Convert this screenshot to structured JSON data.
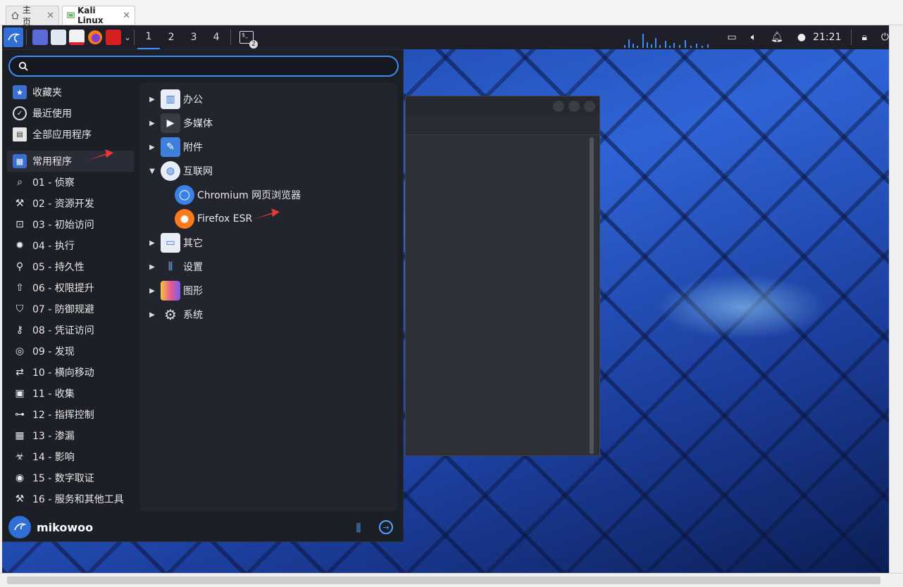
{
  "host": {
    "tabs": [
      {
        "label": "主页",
        "icon": "home-icon"
      },
      {
        "label": "Kali Linux",
        "icon": "vm-icon"
      }
    ]
  },
  "panel": {
    "workspaces": [
      "1",
      "2",
      "3",
      "4"
    ],
    "terminal_badge": "2",
    "clock": "21:21"
  },
  "menu": {
    "search": {
      "placeholder": "",
      "value": ""
    },
    "categories": [
      {
        "label": "收藏夹",
        "icon": "star-icon"
      },
      {
        "label": "最近使用",
        "icon": "recent-icon"
      },
      {
        "label": "全部应用程序",
        "icon": "all-apps-icon"
      },
      {
        "label": "常用程序",
        "icon": "grid-icon"
      },
      {
        "label": "01 - 侦察",
        "icon": "magnifier-icon"
      },
      {
        "label": "02 - 资源开发",
        "icon": "hammer-icon"
      },
      {
        "label": "03 - 初始访问",
        "icon": "lock-open-icon"
      },
      {
        "label": "04 - 执行",
        "icon": "explosion-icon"
      },
      {
        "label": "05 - 持久性",
        "icon": "persistence-icon"
      },
      {
        "label": "06 - 权限提升",
        "icon": "arrow-up-icon"
      },
      {
        "label": "07 - 防御规避",
        "icon": "shield-icon"
      },
      {
        "label": "08 - 凭证访问",
        "icon": "key-icon"
      },
      {
        "label": "09 - 发现",
        "icon": "radar-icon"
      },
      {
        "label": "10 - 横向移动",
        "icon": "arrows-lateral-icon"
      },
      {
        "label": "11 - 收集",
        "icon": "archive-icon"
      },
      {
        "label": "12 - 指挥控制",
        "icon": "gamepad-icon"
      },
      {
        "label": "13 - 渗漏",
        "icon": "exfiltration-icon"
      },
      {
        "label": "14 - 影响",
        "icon": "biohazard-icon"
      },
      {
        "label": "15 - 数字取证",
        "icon": "fingerprint-icon"
      },
      {
        "label": "16 - 服务和其他工具",
        "icon": "tools-icon"
      }
    ],
    "apps": [
      {
        "label": "办公",
        "icon": "office-icon",
        "expanded": false
      },
      {
        "label": "多媒体",
        "icon": "multimedia-icon",
        "expanded": false
      },
      {
        "label": "附件",
        "icon": "accessories-icon",
        "expanded": false
      },
      {
        "label": "互联网",
        "icon": "globe-icon",
        "expanded": true
      },
      {
        "label": "Chromium 网页浏览器",
        "icon": "chromium-icon",
        "child": true
      },
      {
        "label": "Firefox ESR",
        "icon": "firefox-icon",
        "child": true
      },
      {
        "label": "其它",
        "icon": "other-icon",
        "expanded": false
      },
      {
        "label": "设置",
        "icon": "settings-sliders-icon",
        "expanded": false
      },
      {
        "label": "图形",
        "icon": "graphics-icon",
        "expanded": false
      },
      {
        "label": "系统",
        "icon": "gear-icon",
        "expanded": false
      }
    ],
    "username": "mikowoo"
  },
  "colors": {
    "accent": "#3f8cff",
    "annotation_arrow": "#e8393a",
    "menu_bg": "#1d1f27"
  }
}
